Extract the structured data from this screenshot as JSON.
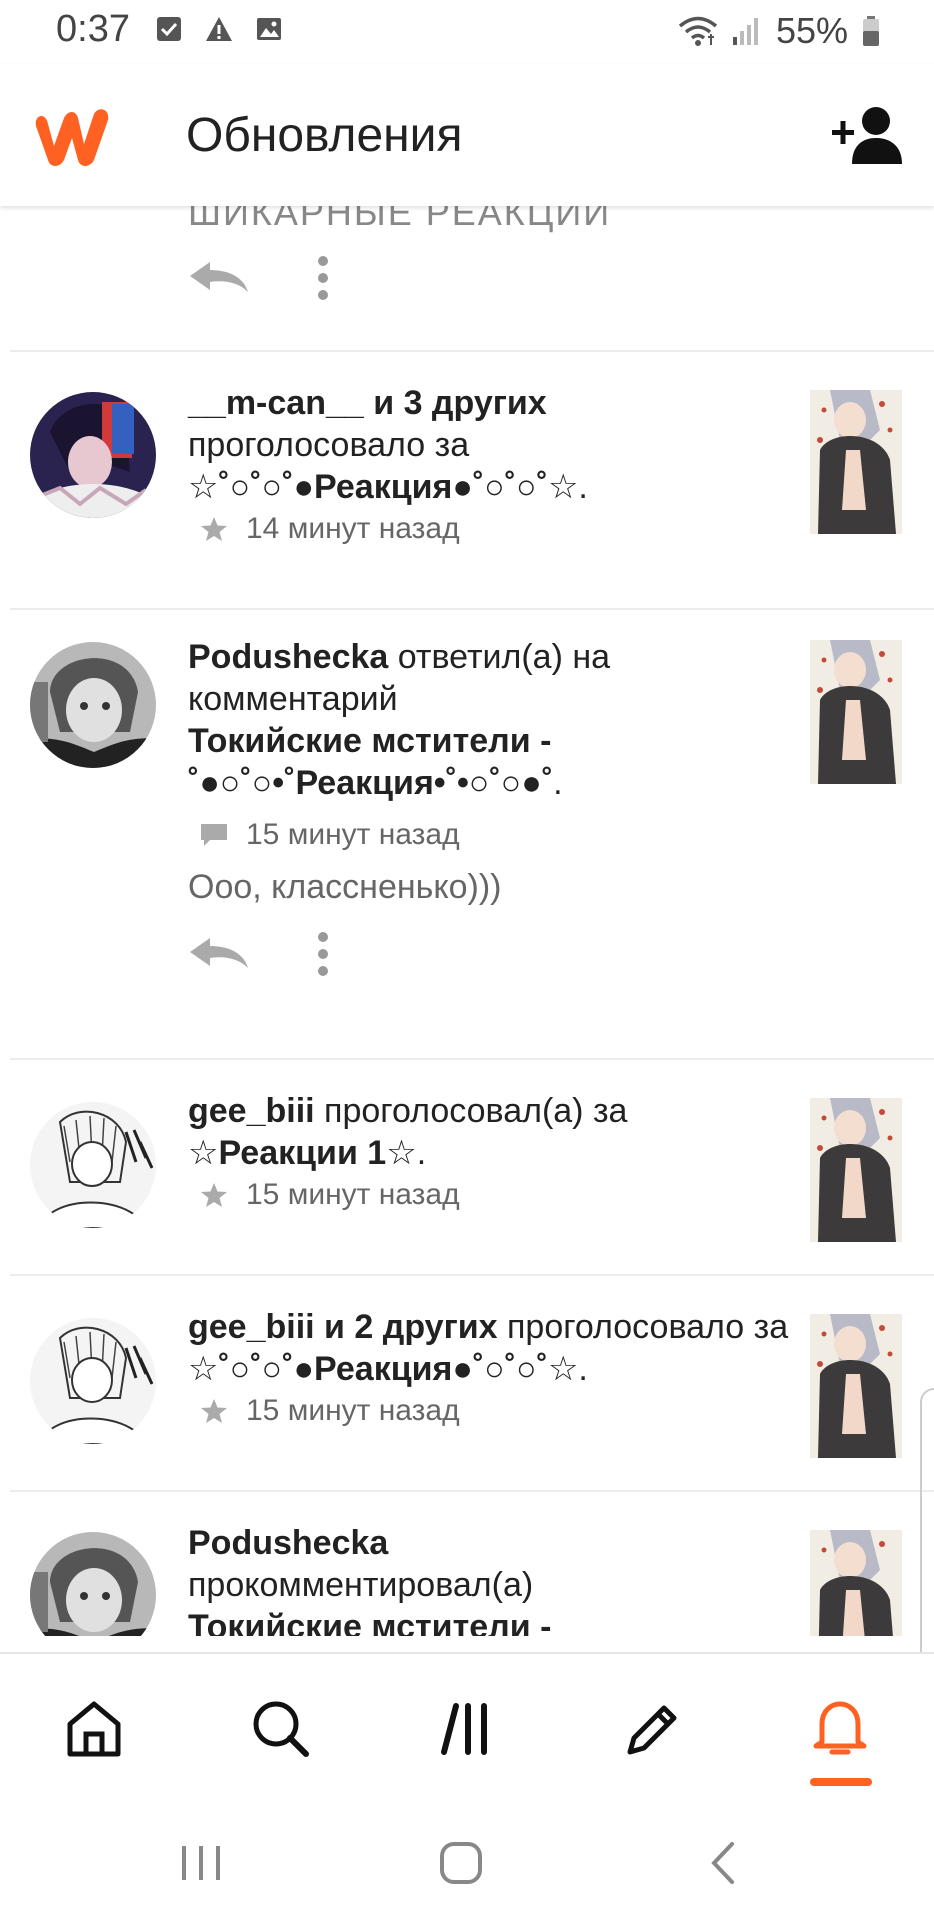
{
  "status_bar": {
    "time": "0:37",
    "battery": "55%",
    "icons": [
      "checkbox-icon",
      "warning-icon",
      "image-icon",
      "wifi-icon",
      "signal-icon",
      "battery-icon"
    ]
  },
  "header": {
    "title": "Обновления",
    "logo_icon": "wattpad-logo-icon",
    "add_friend_icon": "add-person-icon",
    "brand_color": "#ff6122"
  },
  "feed": {
    "partial_text": "ШИКАРНЫЕ РЕАКЦИИ",
    "notifications": [
      {
        "user": "__m-can__ и 3 других",
        "action": " проголосовало за",
        "target": "☆˚○˚○˚●Реакция●˚○˚○˚☆",
        "suffix": ".",
        "meta_icon": "star-icon",
        "time": "14 минут назад"
      },
      {
        "user": "Podushecka",
        "action": " ответил(а) на комментарий",
        "target": "Токийские мстители - ˚●○˚○•˚Реакция•˚•○˚○●˚",
        "suffix": ".",
        "meta_icon": "comment-icon",
        "time": "15 минут назад",
        "reply": "Ооо, классненько)))"
      },
      {
        "user": "gee_biii",
        "action": " проголосовал(а) за",
        "target": "☆Реакции 1☆",
        "suffix": ".",
        "meta_icon": "star-icon",
        "time": "15 минут назад"
      },
      {
        "user": "gee_biii и 2 других",
        "action": " проголосовало за",
        "target": "☆˚○˚○˚●Реакция●˚○˚○˚☆",
        "suffix": ".",
        "meta_icon": "star-icon",
        "time": "15 минут назад"
      },
      {
        "user": "Podushecka",
        "action": " прокомментировал(а)",
        "target": "Токийские мстители -",
        "suffix": ""
      }
    ]
  },
  "bottom_nav": {
    "items": [
      "home-icon",
      "search-icon",
      "library-icon",
      "write-icon",
      "notifications-icon"
    ],
    "active": "notifications-icon",
    "active_color": "#ff6122"
  },
  "system_nav": [
    "recent-apps-icon",
    "home-button-icon",
    "back-icon"
  ]
}
